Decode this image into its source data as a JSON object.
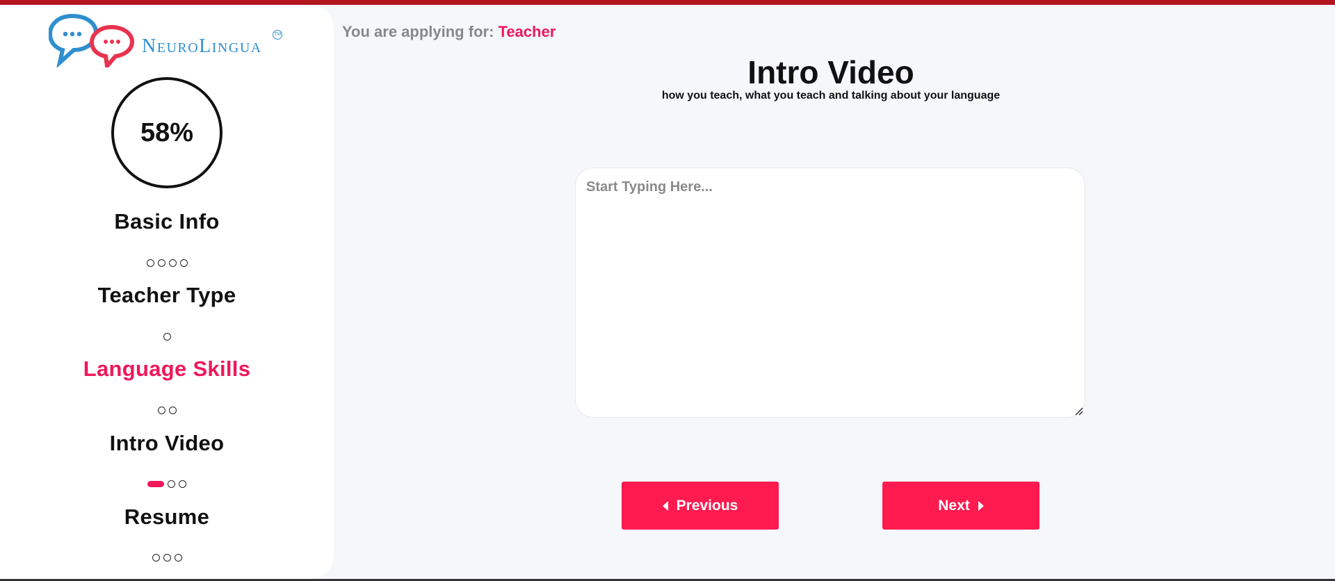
{
  "brand": {
    "name": "NeuroLingua",
    "trademark": "TM"
  },
  "progress": {
    "percent_label": "58%",
    "value": 0.58
  },
  "steps": [
    {
      "title": "Basic Info",
      "active": false,
      "dots": 4,
      "filled_index": -1
    },
    {
      "title": "Teacher Type",
      "active": false,
      "dots": 1,
      "filled_index": -1
    },
    {
      "title": "Language Skills",
      "active": true,
      "dots": 2,
      "filled_index": -1
    },
    {
      "title": "Intro Video",
      "active": false,
      "dots": 3,
      "filled_index": 0
    },
    {
      "title": "Resume",
      "active": false,
      "dots": 3,
      "filled_index": -1
    }
  ],
  "header": {
    "applying_label": "You are applying for:",
    "role": "Teacher"
  },
  "main": {
    "title": "Intro Video",
    "subtitle": "how you teach, what you teach and talking about your language",
    "textarea_value": "",
    "textarea_placeholder": "Start Typing Here..."
  },
  "buttons": {
    "previous_label": "Previous",
    "next_label": "Next"
  },
  "colors": {
    "accent": "#ff1a4f",
    "accent_text": "#f0175a",
    "top_bar": "#b3161f",
    "logo_blue": "#2f8fcf",
    "logo_red": "#e8334f",
    "page_bg": "#f6f7fb"
  },
  "icons": [
    "logo-chat-bubbles-icon",
    "caret-left-icon",
    "caret-right-icon",
    "resize-handle-icon"
  ]
}
